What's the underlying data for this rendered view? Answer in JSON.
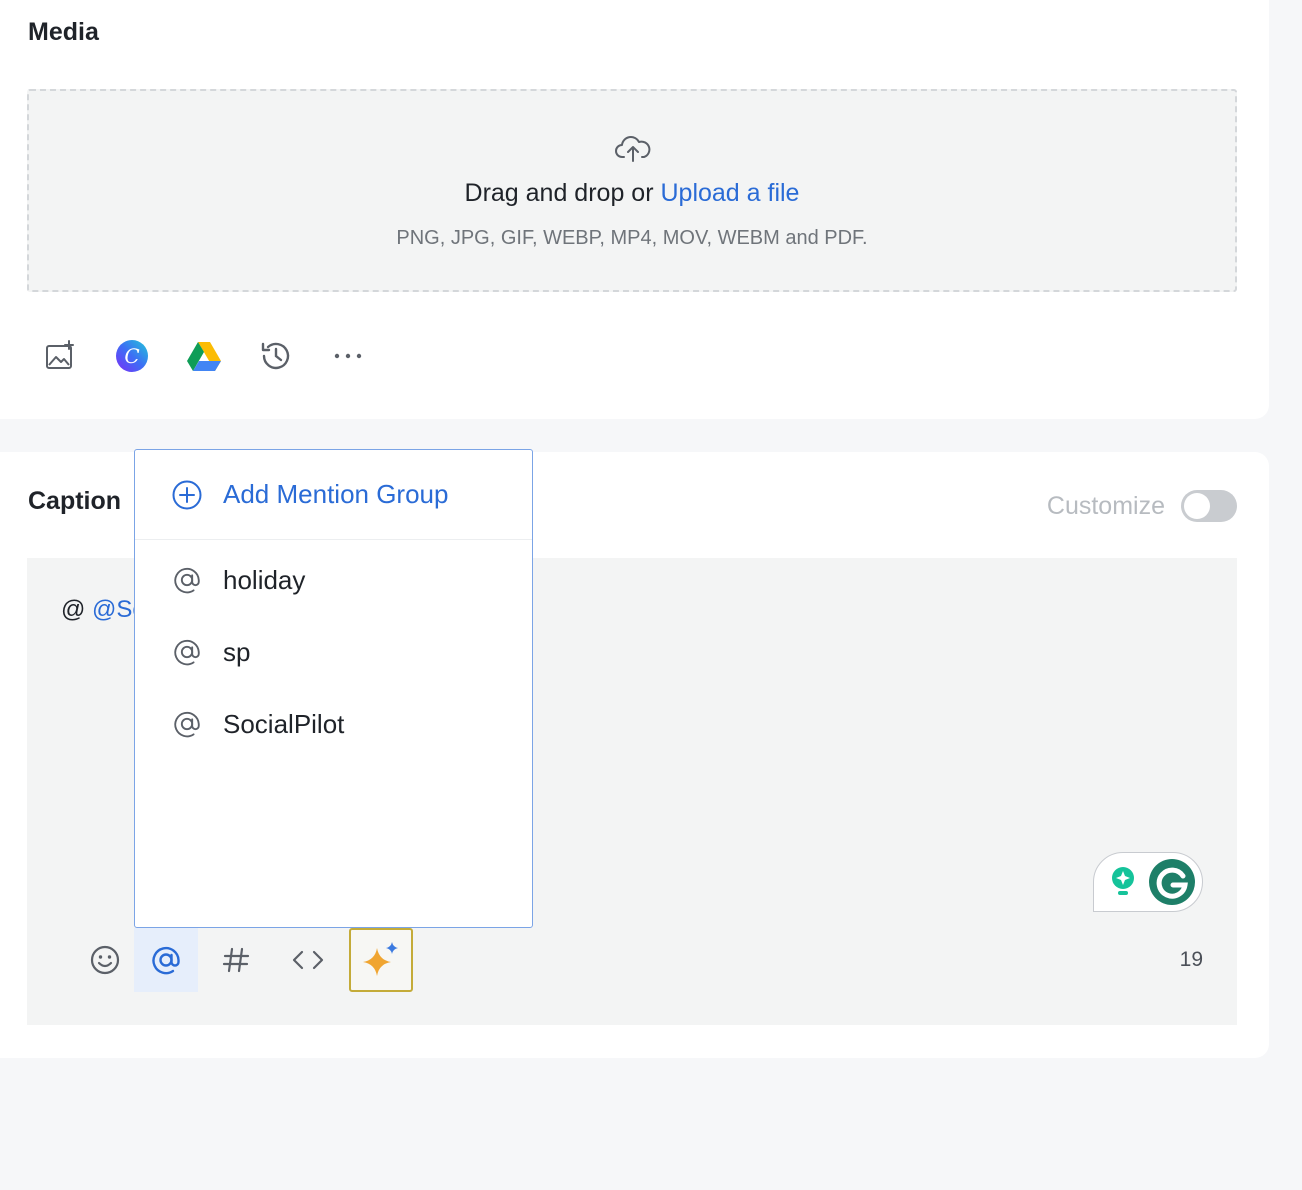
{
  "media": {
    "title": "Media",
    "dropzone": {
      "prefix": "Drag and drop or",
      "link": "Upload a file",
      "formats": "PNG, JPG, GIF, WEBP, MP4, MOV, WEBM and PDF."
    },
    "tools": [
      "add-image-icon",
      "canva-icon",
      "google-drive-icon",
      "history-icon",
      "more-icon"
    ]
  },
  "caption": {
    "title": "Caption",
    "customize_label": "Customize",
    "customize_enabled": false,
    "text_prefix": "@",
    "text_mention": "@Sc",
    "char_count": "19",
    "tools": [
      "emoji-icon",
      "mention-icon",
      "hashtag-icon",
      "code-icon",
      "ai-sparkle-icon"
    ],
    "active_tool": "mention-icon"
  },
  "mention_dropdown": {
    "add_label": "Add Mention Group",
    "items": [
      {
        "label": "holiday"
      },
      {
        "label": "sp"
      },
      {
        "label": "SocialPilot"
      }
    ]
  },
  "colors": {
    "accent": "#2a6bd6",
    "grammarly": "#15c39a"
  }
}
